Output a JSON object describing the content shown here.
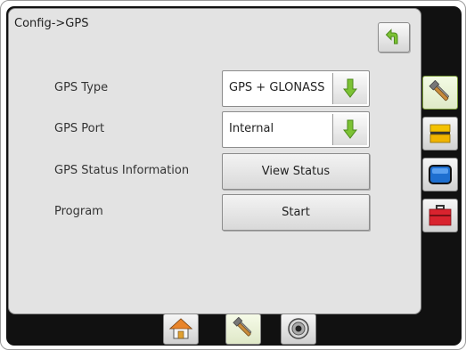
{
  "header": {
    "title": "Config->GPS"
  },
  "rows": [
    {
      "label": "GPS Type",
      "value": "GPS + GLONASS"
    },
    {
      "label": "GPS Port",
      "value": "Internal"
    },
    {
      "label": "GPS Status Information",
      "button": "View Status"
    },
    {
      "label": "Program",
      "button": "Start"
    }
  ],
  "icons": {
    "back": "back-arrow-icon",
    "dropdown": "down-arrow-icon",
    "side_tabs": [
      "tools-icon",
      "implement-icon",
      "screen-icon",
      "toolbox-icon"
    ],
    "bottom_tabs": [
      "home-icon",
      "tools-icon",
      "guidance-icon"
    ]
  },
  "colors": {
    "accent_green": "#7cc234",
    "toolbox_red": "#d9232e",
    "implement_yellow": "#f0b400",
    "screen_blue": "#1e6fd0"
  }
}
